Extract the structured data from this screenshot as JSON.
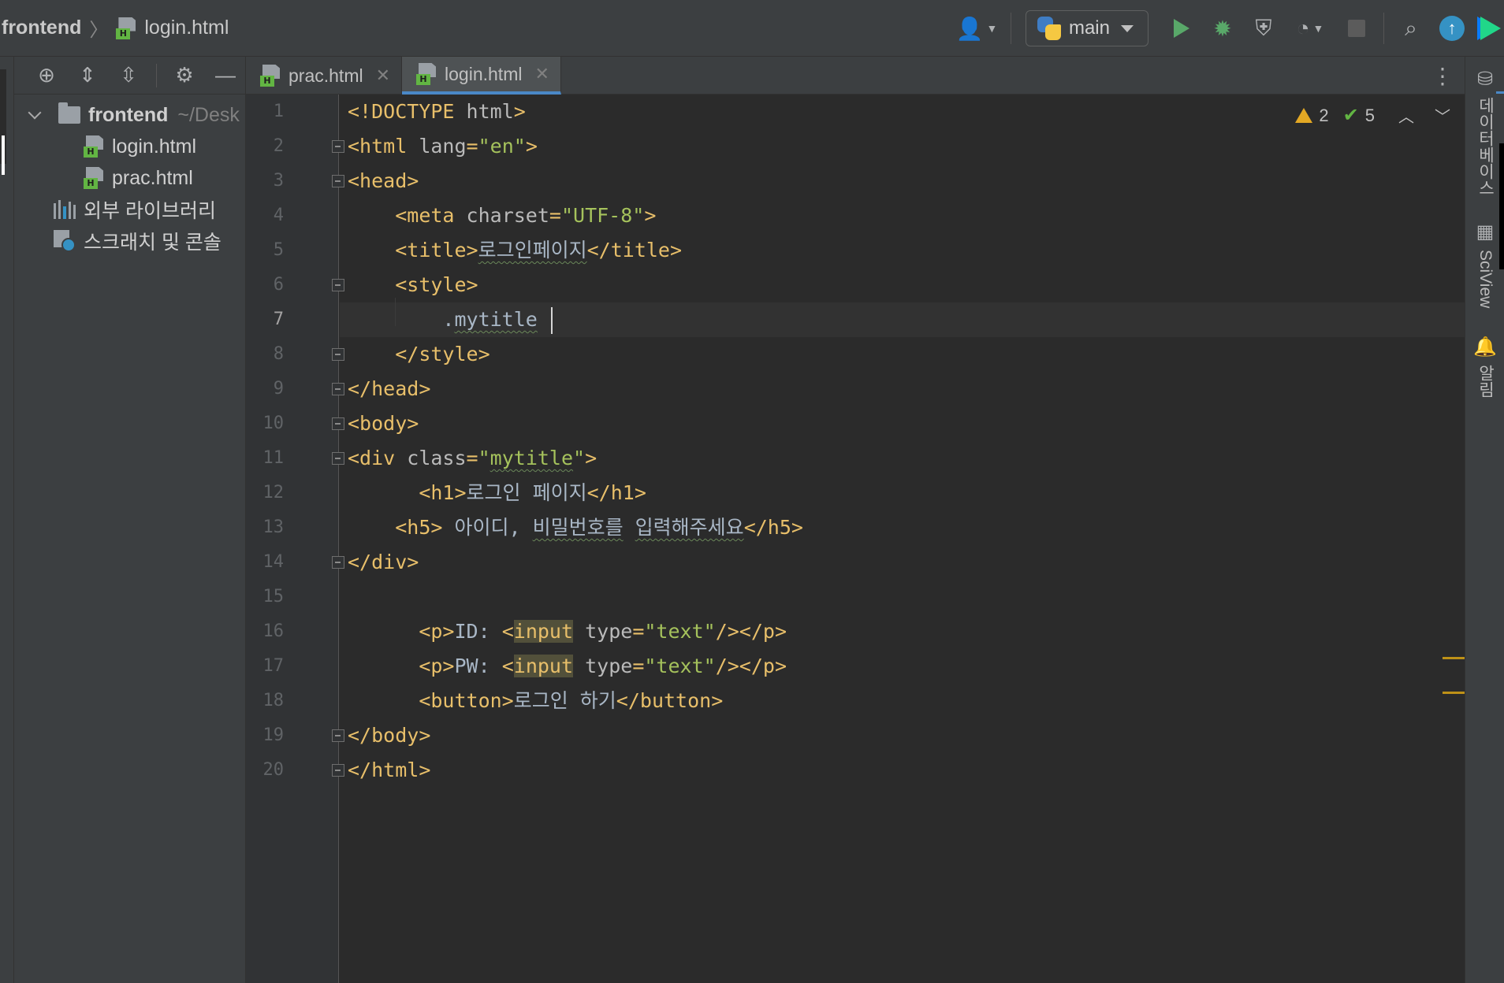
{
  "breadcrumb": {
    "project": "frontend",
    "file": "login.html"
  },
  "toolbar": {
    "branch": "main",
    "icons": [
      "user-icon",
      "python-icon",
      "run-icon",
      "debug-icon",
      "coverage-icon",
      "profile-icon",
      "stop-icon",
      "search-icon",
      "update-icon",
      "jetbrains-icon"
    ]
  },
  "project_panel": {
    "root_name": "frontend",
    "root_path": "~/Desk",
    "files": [
      "login.html",
      "prac.html"
    ],
    "external_libraries": "외부 라이브러리",
    "scratches": "스크래치 및 콘솔"
  },
  "tabs": [
    {
      "label": "prac.html",
      "active": false
    },
    {
      "label": "login.html",
      "active": true
    }
  ],
  "inspections": {
    "warnings": "2",
    "ok": "5"
  },
  "editor": {
    "current_line": "7",
    "line_numbers": [
      "1",
      "2",
      "3",
      "4",
      "5",
      "6",
      "7",
      "8",
      "9",
      "10",
      "11",
      "12",
      "13",
      "14",
      "15",
      "16",
      "17",
      "18",
      "19",
      "20"
    ],
    "lines": [
      "<!DOCTYPE html>",
      "<html lang=\"en\">",
      "<head>",
      "    <meta charset=\"UTF-8\">",
      "    <title>로그인페이지</title>",
      "    <style>",
      "        .mytitle ",
      "    </style>",
      "</head>",
      "<body>",
      "<div class=\"mytitle\">",
      "      <h1>로그인 페이지</h1>",
      "    <h5> 아이디, 비밀번호를 입력해주세요</h5>",
      "</div>",
      "",
      "      <p>ID: <input type=\"text\"/></p>",
      "      <p>PW: <input type=\"text\"/></p>",
      "      <button>로그인 하기</button>",
      "</body>",
      "</html>"
    ]
  },
  "right_sidebar": {
    "database": "데이터베이스",
    "sciview": "SciView",
    "notifications": "알림"
  },
  "colors": {
    "background": "#2b2b2b",
    "panel": "#3c3f41",
    "tag": "#e8bf6a",
    "string": "#a5c25c",
    "accent": "#4a88c7"
  }
}
